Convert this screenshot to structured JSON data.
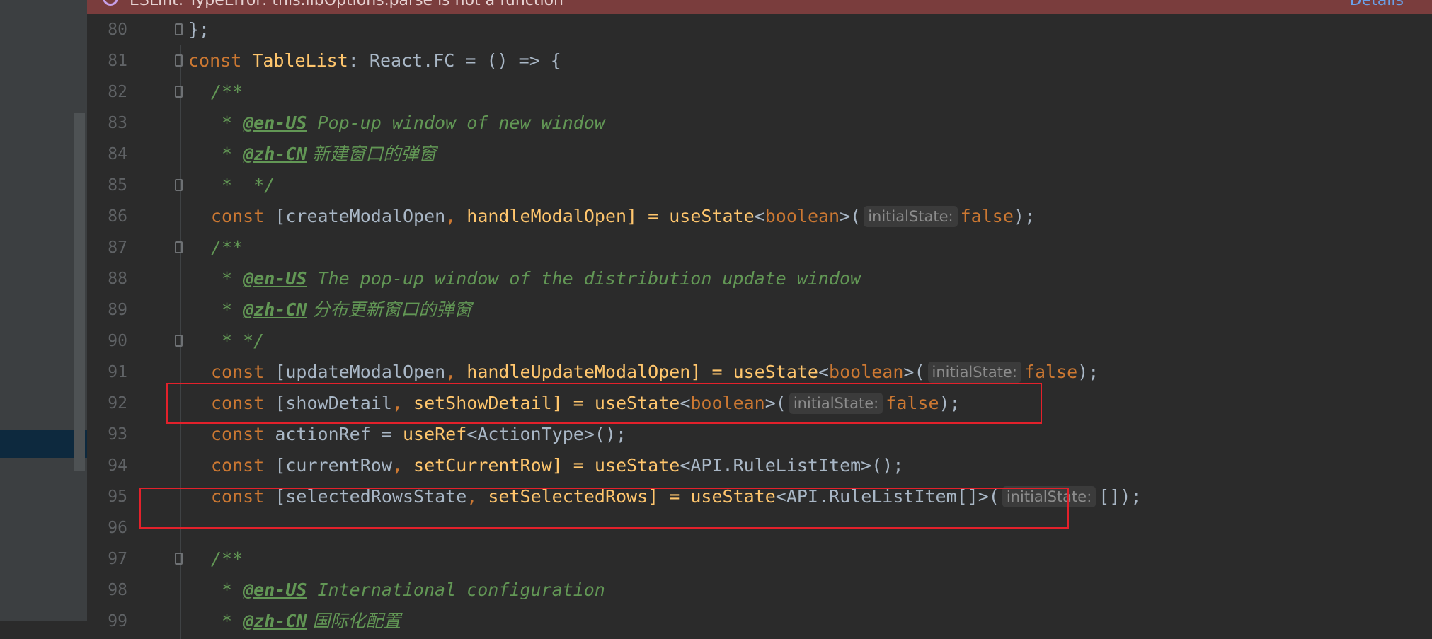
{
  "banner": {
    "text": "ESLint: TypeError: this.libOptions.parse is not a function",
    "link": "Details"
  },
  "colors": {
    "keyword": "#cc7832",
    "function": "#ffc66d",
    "comment": "#629755",
    "text": "#a9b7c6",
    "highlight_border": "#e3212b",
    "banner_bg": "#7a3d3d"
  },
  "lines": [
    {
      "num": "80",
      "t": [
        "};"
      ]
    },
    {
      "num": "81",
      "t": [
        "const",
        "TableList",
        "React.FC",
        "= () => {"
      ]
    },
    {
      "num": "82",
      "t": [
        "/**"
      ]
    },
    {
      "num": "83",
      "t": [
        "* ",
        "@en-US",
        " Pop-up window of new window"
      ]
    },
    {
      "num": "84",
      "t": [
        "* ",
        "@zh-CN",
        " 新建窗口的弹窗"
      ]
    },
    {
      "num": "85",
      "t": [
        "*  */"
      ]
    },
    {
      "num": "86",
      "t": [
        "const",
        "[createModalOpen",
        "handleModalOpen] = ",
        "useState",
        "boolean",
        "initialState:",
        "false"
      ]
    },
    {
      "num": "87",
      "t": [
        "/**"
      ]
    },
    {
      "num": "88",
      "t": [
        "* ",
        "@en-US",
        " The pop-up window of the distribution update window"
      ]
    },
    {
      "num": "89",
      "t": [
        "* ",
        "@zh-CN",
        " 分布更新窗口的弹窗"
      ]
    },
    {
      "num": "90",
      "t": [
        "* */"
      ]
    },
    {
      "num": "91",
      "t": [
        "const",
        "[updateModalOpen",
        "handleUpdateModalOpen] = ",
        "useState",
        "boolean",
        "initialState:",
        "false"
      ]
    },
    {
      "num": "92",
      "t": [
        "const",
        "[showDetail",
        "setShowDetail] = ",
        "useState",
        "boolean",
        "initialState:",
        "false"
      ]
    },
    {
      "num": "93",
      "t": [
        "const",
        "actionRef = ",
        "useRef",
        "<ActionType>();"
      ]
    },
    {
      "num": "94",
      "t": [
        "const",
        "[currentRow",
        "setCurrentRow] = ",
        "useState",
        "<API.RuleListItem>();"
      ]
    },
    {
      "num": "95",
      "t": [
        "const",
        "[selectedRowsState",
        "setSelectedRows] = ",
        "useState",
        "<API.RuleListItem[]>(",
        "initialState:",
        "[]);"
      ]
    },
    {
      "num": "96",
      "t": []
    },
    {
      "num": "97",
      "t": [
        "/**"
      ]
    },
    {
      "num": "98",
      "t": [
        "* ",
        "@en-US",
        " International configuration"
      ]
    },
    {
      "num": "99",
      "t": [
        "* ",
        "@zh-CN",
        " 国际化配置"
      ]
    }
  ]
}
